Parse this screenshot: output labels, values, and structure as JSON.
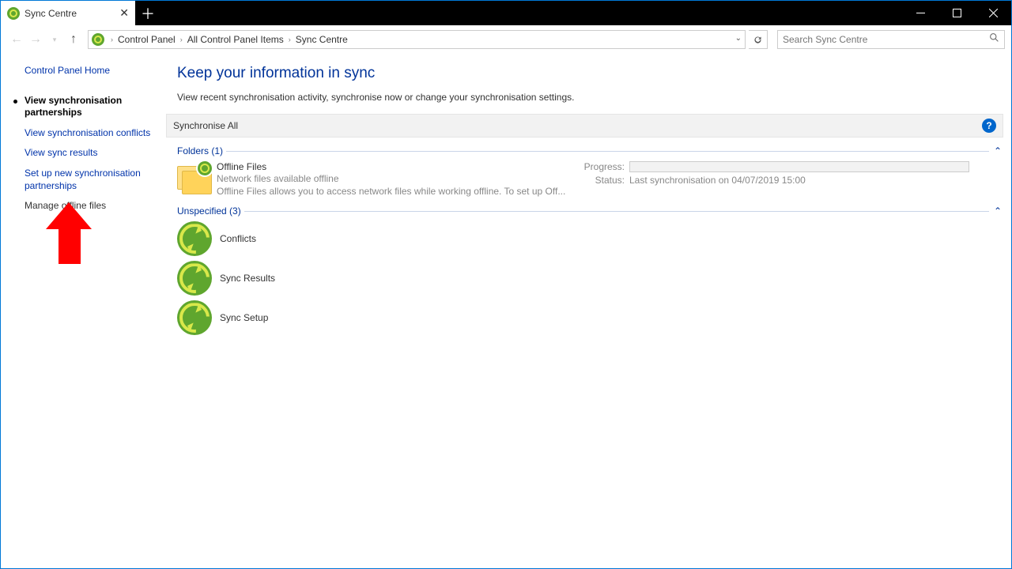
{
  "window": {
    "tab_title": "Sync Centre"
  },
  "breadcrumb": {
    "items": [
      "Control Panel",
      "All Control Panel Items",
      "Sync Centre"
    ]
  },
  "search": {
    "placeholder": "Search Sync Centre"
  },
  "sidebar": {
    "home": "Control Panel Home",
    "items": [
      "View synchronisation partnerships",
      "View synchronisation conflicts",
      "View sync results",
      "Set up new synchronisation partnerships",
      "Manage offline files"
    ]
  },
  "main": {
    "title": "Keep your information in sync",
    "subtitle": "View recent synchronisation activity, synchronise now or change your synchronisation settings.",
    "sync_all": "Synchronise All",
    "groups": {
      "folders": {
        "header": "Folders (1)",
        "item": {
          "title": "Offline Files",
          "line1": "Network files available offline",
          "line2": "Offline Files allows you to access network files while working offline. To set up Off...",
          "progress_label": "Progress:",
          "status_label": "Status:",
          "status_value": "Last synchronisation on 04/07/2019 15:00"
        }
      },
      "unspecified": {
        "header": "Unspecified (3)",
        "items": [
          "Conflicts",
          "Sync Results",
          "Sync Setup"
        ]
      }
    }
  },
  "help_tooltip": "?"
}
